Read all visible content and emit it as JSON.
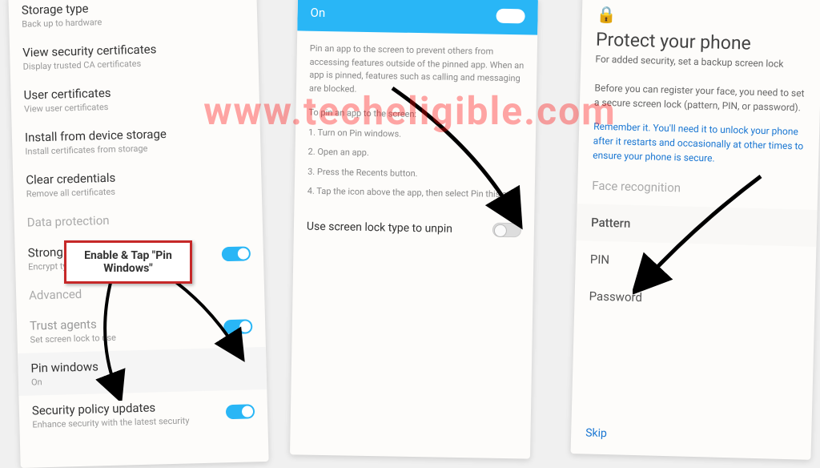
{
  "watermark": "www.techeligible.com",
  "callout": "Enable & Tap \"Pin Windows\"",
  "phone1": {
    "storage_type": {
      "title": "Storage type",
      "sub": "Back up to hardware"
    },
    "view_certs": {
      "title": "View security certificates",
      "sub": "Display trusted CA certificates"
    },
    "user_certs": {
      "title": "User certificates",
      "sub": "View user certificates"
    },
    "install": {
      "title": "Install from device storage",
      "sub": "Install certificates from storage"
    },
    "clear": {
      "title": "Clear credentials",
      "sub": "Remove all certificates"
    },
    "data_prot": {
      "title": "Data protection"
    },
    "strong": {
      "title": "Strong",
      "sub": "Encrypt type"
    },
    "advanced": {
      "title": "Advanced"
    },
    "trust": {
      "title": "Trust agents",
      "sub": "Set screen lock to use"
    },
    "pin_win": {
      "title": "Pin windows",
      "sub": "On"
    },
    "sec_policy": {
      "title": "Security policy updates",
      "sub": "Enhance security with the latest security"
    }
  },
  "phone2": {
    "header": "On",
    "desc": "Pin an app to the screen to prevent others from accessing features outside of the pinned app. When an app is pinned, features such as calling and messaging are blocked.",
    "instr_title": "To pin an app to the screen:",
    "step1": "1. Turn on Pin windows.",
    "step2": "2. Open an app.",
    "step3": "3. Press the Recents button.",
    "step4": "4. Tap the icon above the app, then select Pin this app.",
    "unpin": "Use screen lock type to unpin"
  },
  "phone3": {
    "title": "Protect your phone",
    "subtitle": "For added security, set a backup screen lock",
    "body1": "Before you can register your face, you need to set a secure screen lock (pattern, PIN, or password).",
    "body2": "Remember it. You'll need it to unlock your phone after it restarts and occasionally at other times to ensure your phone is secure.",
    "face": "Face recognition",
    "pattern": "Pattern",
    "pin": "PIN",
    "password": "Password",
    "skip": "Skip"
  }
}
